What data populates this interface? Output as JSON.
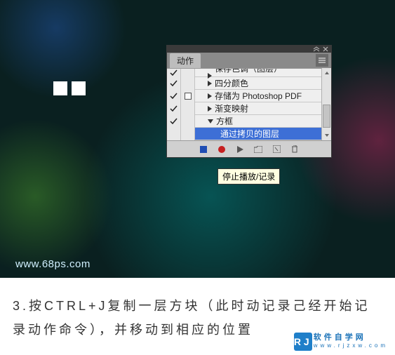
{
  "panel": {
    "tab_label": "动作",
    "actions": [
      {
        "label": "保存色调（图层）",
        "checked": true,
        "box": false,
        "triangle": "right",
        "indent": 1,
        "cutoff": true
      },
      {
        "label": "四分颜色",
        "checked": true,
        "box": false,
        "triangle": "right",
        "indent": 1
      },
      {
        "label": "存储为 Photoshop PDF",
        "checked": true,
        "box": true,
        "triangle": "right",
        "indent": 1
      },
      {
        "label": "渐变映射",
        "checked": true,
        "box": false,
        "triangle": "right",
        "indent": 1
      },
      {
        "label": "方框",
        "checked": true,
        "box": false,
        "triangle": "down",
        "indent": 1
      },
      {
        "label": "通过拷贝的图层",
        "checked": false,
        "box": false,
        "triangle": null,
        "indent": 2,
        "selected": true
      }
    ]
  },
  "tooltip": "停止播放/记录",
  "watermark": "www.68ps.com",
  "instruction": "3.按CTRL+J复制一层方块（此时动记录己经开始记录动作命令），并移动到相应的位置",
  "logo": {
    "zh": "软件自学网",
    "url": "www.rjzxw.com",
    "badge": "RJ"
  }
}
